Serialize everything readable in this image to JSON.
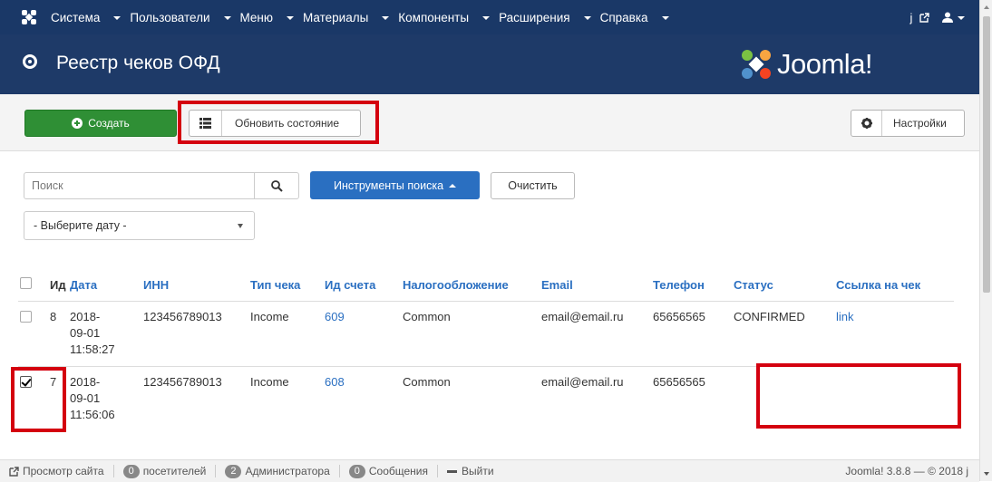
{
  "topnav": {
    "menu": [
      "Система",
      "Пользователи",
      "Меню",
      "Материалы",
      "Компоненты",
      "Расширения",
      "Справка"
    ],
    "user_link": "j"
  },
  "header": {
    "title": "Реестр чеков ОФД",
    "brand": "Joomla!"
  },
  "toolbar": {
    "create_label": "Создать",
    "update_label": "Обновить состояние",
    "settings_label": "Настройки"
  },
  "filters": {
    "search_placeholder": "Поиск",
    "search_tools_label": "Инструменты поиска",
    "clear_label": "Очистить",
    "date_select": "- Выберите дату -"
  },
  "table": {
    "columns": [
      "Ид",
      "Дата",
      "ИНН",
      "Тип чека",
      "Ид счета",
      "Налогообложение",
      "Email",
      "Телефон",
      "Статус",
      "Ссылка на чек"
    ],
    "rows": [
      {
        "id": "8",
        "date_l1": "2018-",
        "date_l2": "09-01",
        "date_l3": "11:58:27",
        "inn": "123456789013",
        "type": "Income",
        "invoice": "609",
        "tax": "Common",
        "email": "email@email.ru",
        "phone": "65656565",
        "status": "CONFIRMED",
        "link": "link",
        "checked": false
      },
      {
        "id": "7",
        "date_l1": "2018-",
        "date_l2": "09-01",
        "date_l3": "11:56:06",
        "inn": "123456789013",
        "type": "Income",
        "invoice": "608",
        "tax": "Common",
        "email": "email@email.ru",
        "phone": "65656565",
        "status": "",
        "link": "",
        "checked": true
      }
    ]
  },
  "statusbar": {
    "view_site": "Просмотр сайта",
    "visitors_count": "0",
    "visitors_label": "посетителей",
    "admins_count": "2",
    "admins_label": "Администратора",
    "messages_count": "0",
    "messages_label": "Сообщения",
    "logout": "Выйти",
    "version": "Joomla! 3.8.8 — © 2018 j"
  },
  "colors": {
    "navbar": "#1a3867",
    "header": "#1e3a68",
    "create_button": "#2f8f35",
    "primary": "#2a6fc1",
    "annotation_red": "#d4000f"
  }
}
